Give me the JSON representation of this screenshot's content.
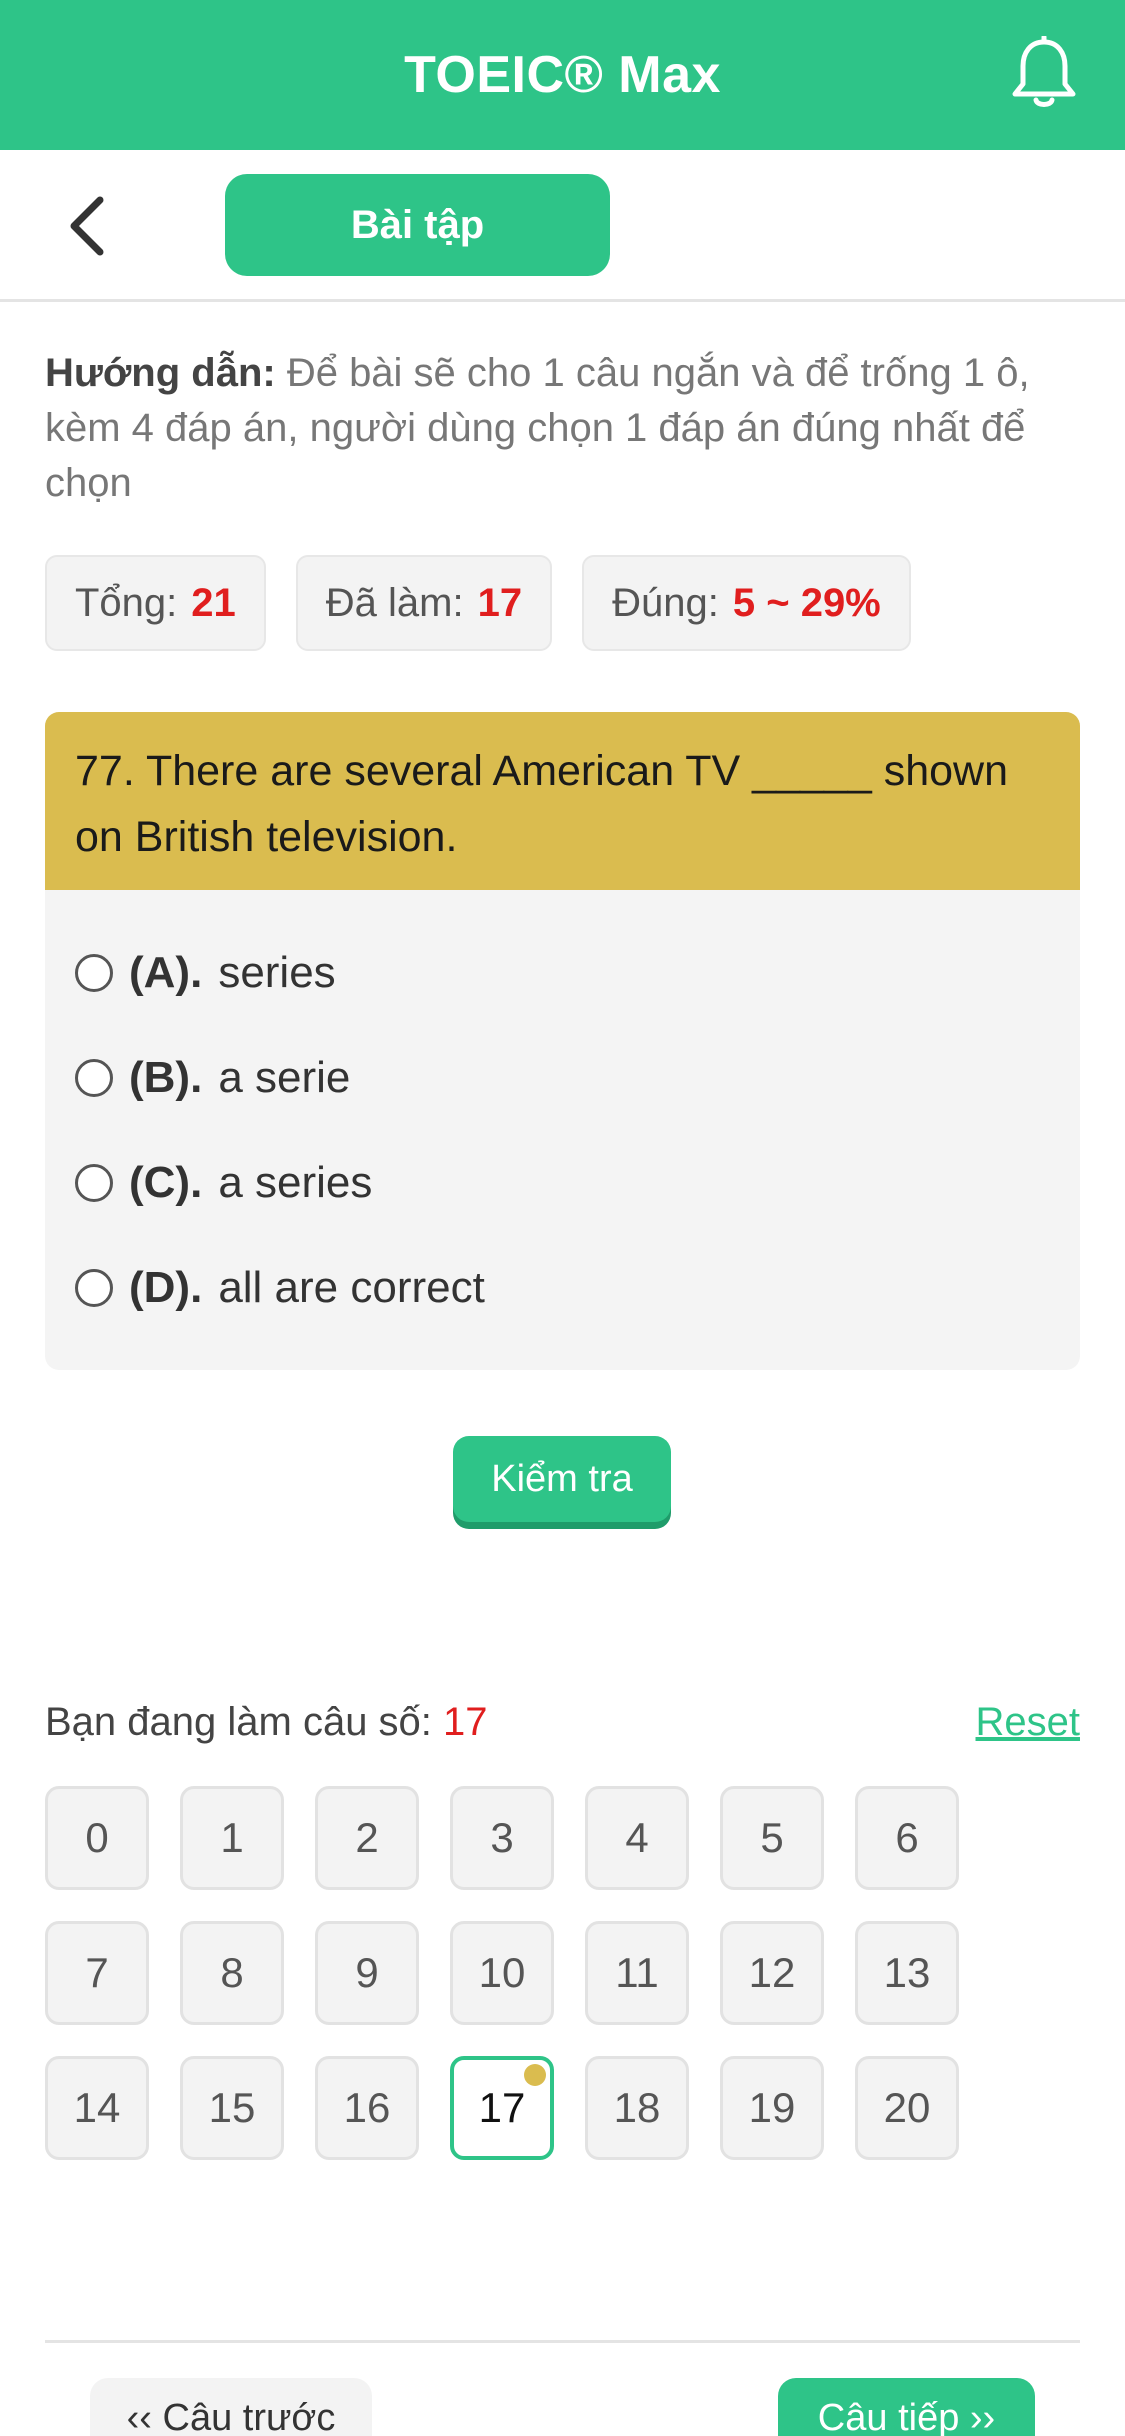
{
  "header": {
    "title": "TOEIC® Max",
    "bell_icon": "bell-icon"
  },
  "subheader": {
    "back_icon": "chevron-left-icon",
    "tab_label": "Bài tập"
  },
  "guide": {
    "label": "Hướng dẫn:",
    "text": " Để bài sẽ cho 1 câu ngắn và để trống 1 ô, kèm 4 đáp án, người dùng chọn 1 đáp án đúng nhất để chọn"
  },
  "stats": {
    "total_label": "Tổng:",
    "total_value": "21",
    "done_label": "Đã làm:",
    "done_value": "17",
    "correct_label": "Đúng:",
    "correct_value": "5 ~ 29%"
  },
  "question": {
    "text": "77. There are several American TV _____ shown on British television.",
    "options": [
      {
        "key": "(A).",
        "text": "series"
      },
      {
        "key": "(B).",
        "text": "a serie"
      },
      {
        "key": "(C).",
        "text": "a series"
      },
      {
        "key": "(D).",
        "text": "all are correct"
      }
    ]
  },
  "check_button": "Kiểm tra",
  "progress": {
    "label": "Bạn đang làm câu số:",
    "current": "17",
    "reset": "Reset"
  },
  "question_numbers": [
    "0",
    "1",
    "2",
    "3",
    "4",
    "5",
    "6",
    "7",
    "8",
    "9",
    "10",
    "11",
    "12",
    "13",
    "14",
    "15",
    "16",
    "17",
    "18",
    "19",
    "20"
  ],
  "active_index": 17,
  "nav": {
    "prev": "‹‹ Câu trước",
    "next": "Câu tiếp ››"
  },
  "colors": {
    "primary": "#2ec488",
    "question_header": "#dabc4f",
    "highlight_red": "#e01e1e"
  }
}
